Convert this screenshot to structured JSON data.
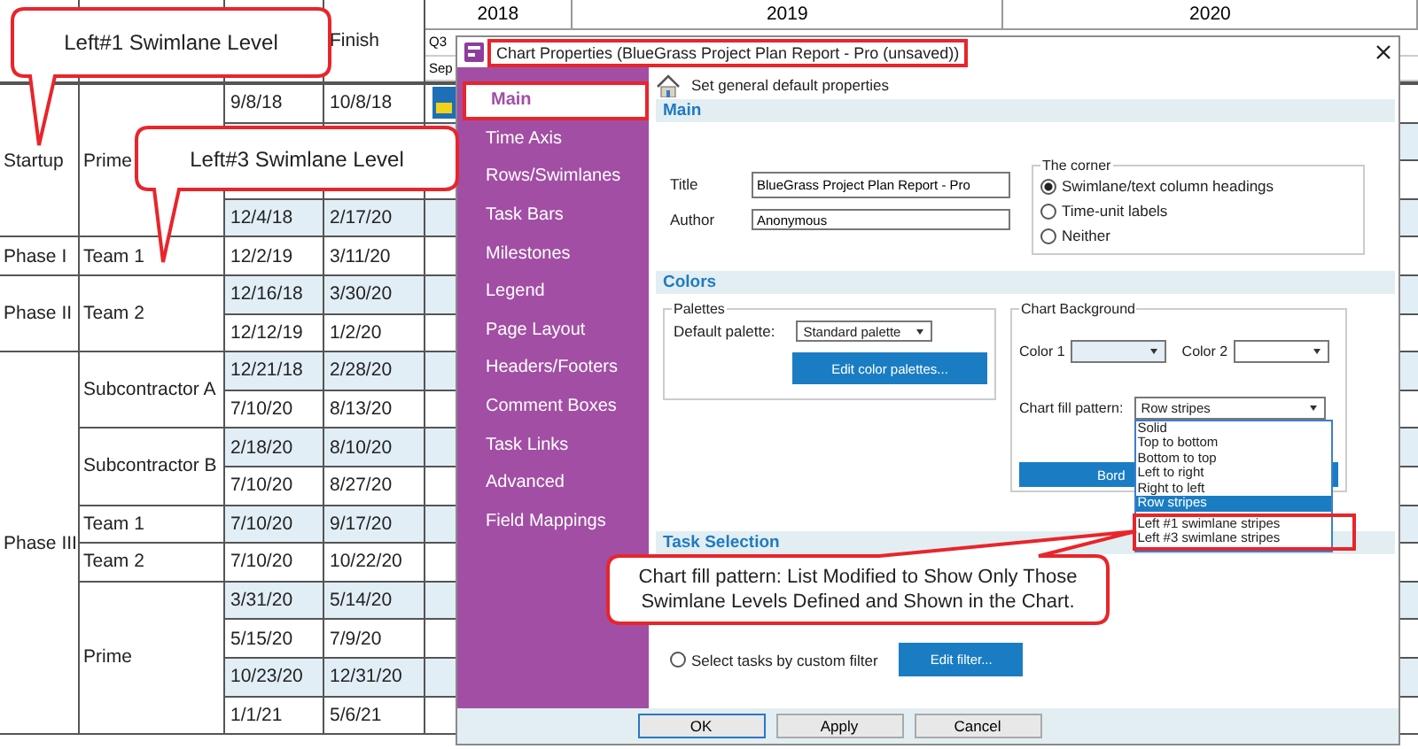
{
  "timeline": {
    "years": [
      "2018",
      "2019",
      "2020"
    ],
    "quarter": "Q3",
    "month": "Sep"
  },
  "table": {
    "finish_header": "Finish",
    "groups": [
      {
        "phase": "Startup",
        "lanes": [
          {
            "name": "Prime",
            "tasks": [
              {
                "start": "9/8/18",
                "finish": "10/8/18"
              },
              {
                "start": "12/4/18",
                "finish": "2/17/20"
              }
            ]
          }
        ]
      },
      {
        "phase": "Phase I",
        "lanes": [
          {
            "name": "Team 1",
            "tasks": [
              {
                "start": "12/2/19",
                "finish": "3/11/20"
              }
            ]
          }
        ]
      },
      {
        "phase": "Phase II",
        "lanes": [
          {
            "name": "Team 2",
            "tasks": [
              {
                "start": "12/16/18",
                "finish": "3/30/20"
              },
              {
                "start": "12/12/19",
                "finish": "1/2/20"
              }
            ]
          }
        ]
      },
      {
        "phase": "Phase III",
        "lanes": [
          {
            "name": "Subcontractor A",
            "tasks": [
              {
                "start": "12/21/18",
                "finish": "2/28/20"
              },
              {
                "start": "7/10/20",
                "finish": "8/13/20"
              }
            ]
          },
          {
            "name": "Subcontractor B",
            "tasks": [
              {
                "start": "2/18/20",
                "finish": "8/10/20"
              },
              {
                "start": "7/10/20",
                "finish": "8/27/20"
              }
            ]
          },
          {
            "name": "Team 1",
            "tasks": [
              {
                "start": "7/10/20",
                "finish": "9/17/20"
              }
            ]
          },
          {
            "name": "Team 2",
            "tasks": [
              {
                "start": "7/10/20",
                "finish": "10/22/20"
              }
            ]
          },
          {
            "name": "Prime",
            "tasks": [
              {
                "start": "3/31/20",
                "finish": "5/14/20"
              },
              {
                "start": "5/15/20",
                "finish": "7/9/20"
              },
              {
                "start": "10/23/20",
                "finish": "12/31/20"
              },
              {
                "start": "1/1/21",
                "finish": "5/6/21"
              }
            ]
          }
        ]
      }
    ]
  },
  "dialog": {
    "title": "Chart Properties (BlueGrass Project Plan Report - Pro (unsaved))",
    "title_marked": true,
    "nav": [
      {
        "label": "Main",
        "selected": true,
        "marked": true
      },
      {
        "label": "Time Axis",
        "selected": false,
        "marked": false
      },
      {
        "label": "Rows/Swimlanes",
        "selected": false,
        "marked": false
      },
      {
        "label": "Task Bars",
        "selected": false,
        "marked": false
      },
      {
        "label": "Milestones",
        "selected": false,
        "marked": false
      },
      {
        "label": "Legend",
        "selected": false,
        "marked": false
      },
      {
        "label": "Page Layout",
        "selected": false,
        "marked": false
      },
      {
        "label": "Headers/Footers",
        "selected": false,
        "marked": false
      },
      {
        "label": "Comment Boxes",
        "selected": false,
        "marked": false
      },
      {
        "label": "Task Links",
        "selected": false,
        "marked": false
      },
      {
        "label": "Advanced",
        "selected": false,
        "marked": false
      },
      {
        "label": "Field Mappings",
        "selected": false,
        "marked": false
      }
    ],
    "subtitle": "Set general default properties",
    "main": {
      "heading": "Main",
      "title_label": "Title",
      "title_value": "BlueGrass Project Plan Report - Pro",
      "author_label": "Author",
      "author_value": "Anonymous",
      "corner": {
        "legend": "The corner",
        "options": [
          {
            "label": "Swimlane/text column headings",
            "selected": true
          },
          {
            "label": "Time-unit labels",
            "selected": false
          },
          {
            "label": "Neither",
            "selected": false
          }
        ]
      }
    },
    "colors": {
      "heading": "Colors",
      "palettes": {
        "legend": "Palettes",
        "label": "Default palette:",
        "value": "Standard palette",
        "button": "Edit color palettes..."
      },
      "background": {
        "legend": "Chart Background",
        "color1_label": "Color 1",
        "color2_label": "Color 2",
        "fill_label": "Chart fill pattern:",
        "fill_value": "Row stripes",
        "expanded": true,
        "button": "Bord",
        "options": [
          {
            "label": "Solid",
            "selected": false,
            "marked": false
          },
          {
            "label": "Top to bottom",
            "selected": false,
            "marked": false
          },
          {
            "label": "Bottom to top",
            "selected": false,
            "marked": false
          },
          {
            "label": "Left to right",
            "selected": false,
            "marked": false
          },
          {
            "label": "Right to left",
            "selected": false,
            "marked": false
          },
          {
            "label": "Row stripes",
            "selected": true,
            "marked": false
          },
          {
            "label": "Left #1 swimlane stripes",
            "selected": false,
            "marked": true
          },
          {
            "label": "Left #3 swimlane stripes",
            "selected": false,
            "marked": true
          }
        ]
      }
    },
    "task_selection": {
      "heading": "Task Selection",
      "filter_option": {
        "label": "Select tasks by custom filter",
        "selected": false
      },
      "filter_button": "Edit filter..."
    },
    "buttons": [
      {
        "label": "OK",
        "default": true
      },
      {
        "label": "Apply",
        "default": false
      },
      {
        "label": "Cancel",
        "default": false
      }
    ]
  },
  "callouts": [
    {
      "text": "Left#1 Swimlane Level"
    },
    {
      "text": "Left#3 Swimlane Level"
    },
    {
      "text": "Chart fill pattern: List Modified to Show Only Those Swimlane Levels Defined and Shown in the Chart."
    }
  ]
}
